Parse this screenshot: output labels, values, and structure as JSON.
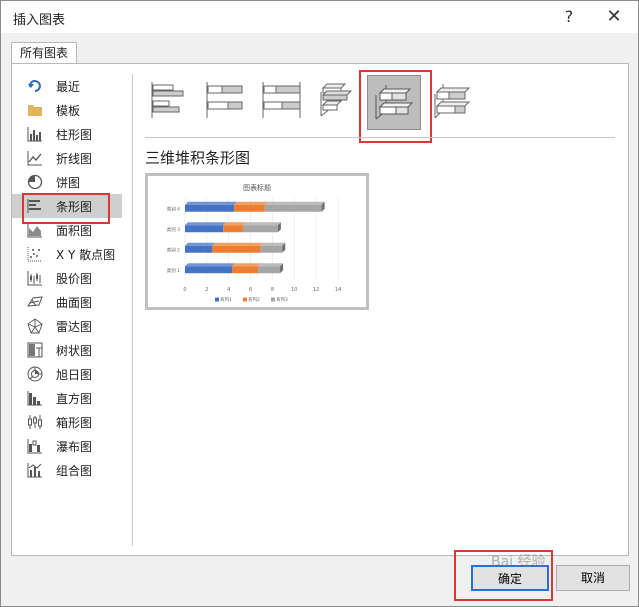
{
  "window": {
    "title": "插入图表",
    "help_label": "?",
    "close_label": "✕"
  },
  "tabs": [
    {
      "label": "所有图表"
    }
  ],
  "sidebar": {
    "items": [
      {
        "label": "最近",
        "icon": "undo-arrow-icon"
      },
      {
        "label": "模板",
        "icon": "folder-icon"
      },
      {
        "label": "柱形图",
        "icon": "column-chart-icon"
      },
      {
        "label": "折线图",
        "icon": "line-chart-icon"
      },
      {
        "label": "饼图",
        "icon": "pie-chart-icon"
      },
      {
        "label": "条形图",
        "icon": "bar-chart-icon",
        "selected": true
      },
      {
        "label": "面积图",
        "icon": "area-chart-icon"
      },
      {
        "label": "X Y 散点图",
        "icon": "scatter-chart-icon"
      },
      {
        "label": "股价图",
        "icon": "stock-chart-icon"
      },
      {
        "label": "曲面图",
        "icon": "surface-chart-icon"
      },
      {
        "label": "雷达图",
        "icon": "radar-chart-icon"
      },
      {
        "label": "树状图",
        "icon": "treemap-chart-icon"
      },
      {
        "label": "旭日图",
        "icon": "sunburst-chart-icon"
      },
      {
        "label": "直方图",
        "icon": "histogram-chart-icon"
      },
      {
        "label": "箱形图",
        "icon": "box-whisker-chart-icon"
      },
      {
        "label": "瀑布图",
        "icon": "waterfall-chart-icon"
      },
      {
        "label": "组合图",
        "icon": "combo-chart-icon"
      }
    ]
  },
  "subtypes": {
    "selected_index": 4,
    "items": [
      {
        "icon": "clustered-bar-icon"
      },
      {
        "icon": "stacked-bar-icon"
      },
      {
        "icon": "100-stacked-bar-icon"
      },
      {
        "icon": "3d-clustered-bar-icon"
      },
      {
        "icon": "3d-stacked-bar-icon"
      },
      {
        "icon": "3d-100-stacked-bar-icon"
      }
    ]
  },
  "main": {
    "heading": "三维堆积条形图"
  },
  "preview": {
    "chart_data": {
      "type": "bar",
      "orientation": "horizontal",
      "stacked": true,
      "title": "图表标题",
      "categories": [
        "类别 1",
        "类别 2",
        "类别 3",
        "类别 4"
      ],
      "series": [
        {
          "name": "系列1",
          "values": [
            4.3,
            2.5,
            3.5,
            4.5
          ],
          "color": "#4472c4"
        },
        {
          "name": "系列2",
          "values": [
            2.4,
            4.4,
            1.8,
            2.8
          ],
          "color": "#ed7d31"
        },
        {
          "name": "系列3",
          "values": [
            2.0,
            2.0,
            3.2,
            5.2
          ],
          "color": "#a5a5a5"
        }
      ],
      "xlim": [
        0,
        14
      ],
      "xticks": [
        "0",
        "2",
        "4",
        "6",
        "8",
        "10",
        "12",
        "14"
      ],
      "legend": "bottom",
      "grid": true
    }
  },
  "buttons": {
    "ok": "确定",
    "cancel": "取消"
  },
  "watermark": "Bai 经验"
}
